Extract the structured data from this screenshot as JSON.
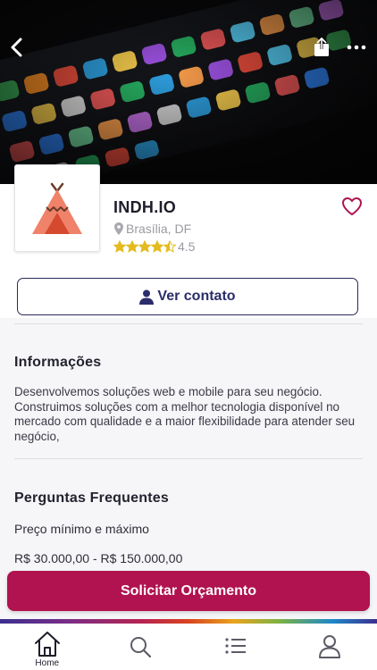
{
  "header": {
    "back_icon": "chevron-left-icon",
    "share_icon": "share-icon",
    "more_icon": "more-horizontal-icon"
  },
  "company": {
    "name": "INDH.IO",
    "location": "Brasília, DF",
    "rating_value": "4.5",
    "rating": 4.5,
    "rating_max": 5,
    "favorite_icon": "heart-outline-icon"
  },
  "contact_button": {
    "label": "Ver contato",
    "icon": "person-icon"
  },
  "info": {
    "title": "Informações",
    "text": "Desenvolvemos soluções web e mobile para seu negócio. Construimos soluções com a melhor tecnologia disponível no mercado com qualidade e a maior flexibilidade para atender seu negócio,"
  },
  "faq": {
    "title": "Perguntas Frequentes",
    "question": "Preço mínimo e máximo",
    "answer": "R$ 30.000,00 - R$ 150.000,00"
  },
  "cta": {
    "label": "Solicitar Orçamento"
  },
  "tabbar": {
    "items": [
      {
        "label": "Home",
        "icon": "home-icon"
      },
      {
        "label": "",
        "icon": "search-icon"
      },
      {
        "label": "",
        "icon": "list-icon"
      },
      {
        "label": "",
        "icon": "user-icon"
      }
    ]
  },
  "colors": {
    "accent": "#b0134f",
    "primary_dark": "#2b2d6b",
    "star": "#e3bb1e",
    "logo_orange": "#f0826a"
  }
}
